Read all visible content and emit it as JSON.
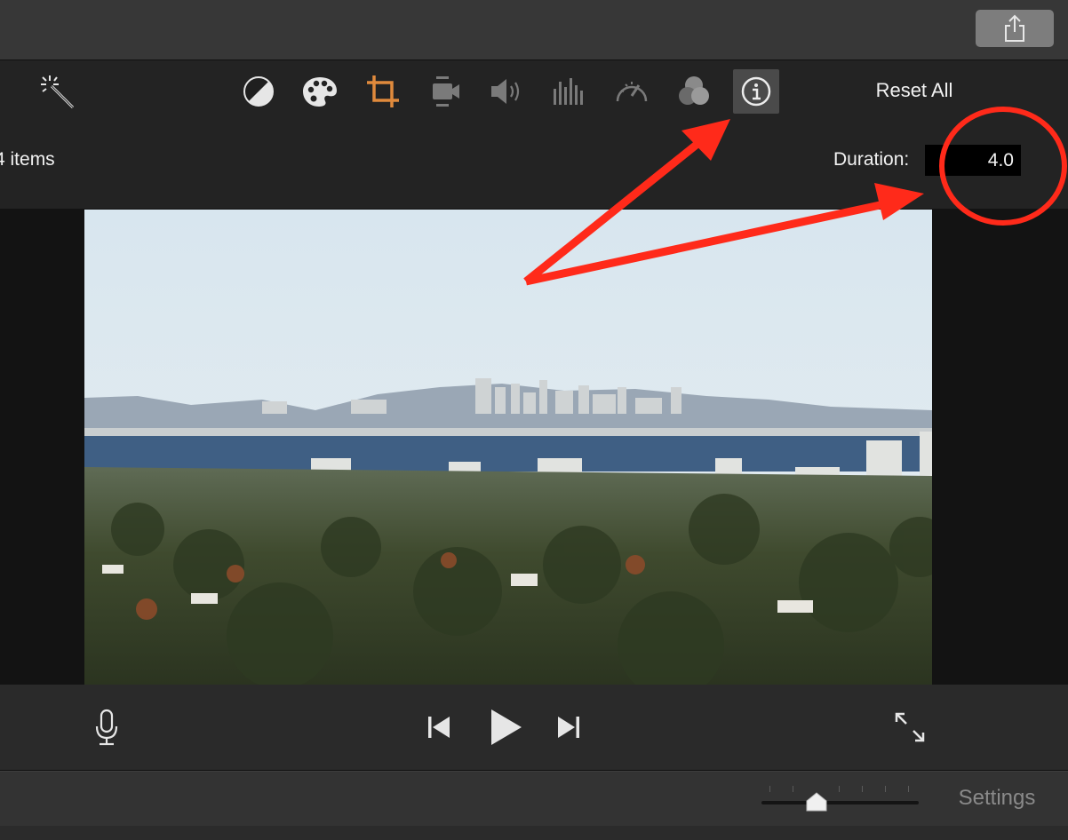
{
  "titlebar": {
    "share_icon": "share-icon"
  },
  "toolbar": {
    "tools": [
      {
        "name": "magic-wand-icon"
      },
      {
        "name": "color-balance-icon"
      },
      {
        "name": "color-correction-palette-icon"
      },
      {
        "name": "crop-icon",
        "active_color": "#e08a3c"
      },
      {
        "name": "stabilization-camera-icon"
      },
      {
        "name": "volume-icon"
      },
      {
        "name": "equalizer-icon"
      },
      {
        "name": "speed-icon"
      },
      {
        "name": "clip-filter-icon"
      },
      {
        "name": "info-icon",
        "selected": true
      }
    ],
    "reset_all_label": "Reset All"
  },
  "info": {
    "items_label": "4 items",
    "duration_label": "Duration:",
    "duration_value": "4.0"
  },
  "viewer": {
    "image_subject": "San Francisco skyline across the bay seen from East Bay hills"
  },
  "playback": {
    "icons": [
      "microphone-icon",
      "skip-back-icon",
      "play-icon",
      "skip-forward-icon",
      "fullscreen-icon"
    ]
  },
  "bottombar": {
    "settings_label": "Settings",
    "zoom_level": 0.35
  },
  "annotation": {
    "color": "#ff2a1a"
  }
}
